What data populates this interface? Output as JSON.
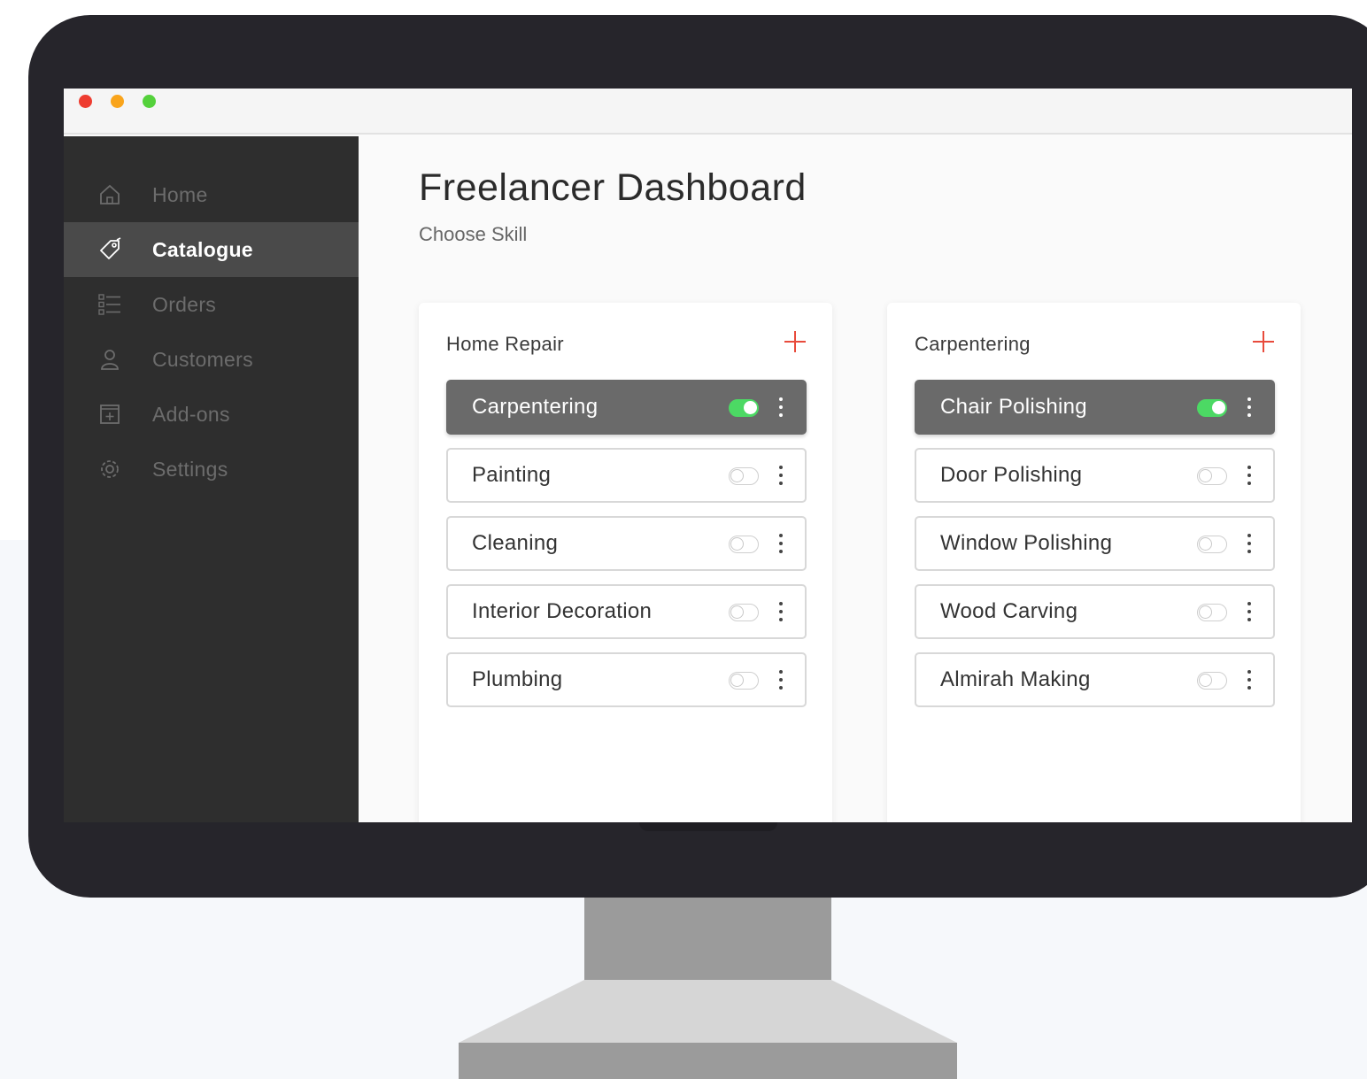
{
  "window": {
    "controls": [
      "close",
      "minimize",
      "maximize"
    ]
  },
  "sidebar": {
    "items": [
      {
        "label": "Home",
        "icon": "home-icon",
        "active": false
      },
      {
        "label": "Catalogue",
        "icon": "tag-icon",
        "active": true
      },
      {
        "label": "Orders",
        "icon": "list-icon",
        "active": false
      },
      {
        "label": "Customers",
        "icon": "user-icon",
        "active": false
      },
      {
        "label": "Add-ons",
        "icon": "add-box-icon",
        "active": false
      },
      {
        "label": "Settings",
        "icon": "gear-icon",
        "active": false
      }
    ]
  },
  "main": {
    "title": "Freelancer Dashboard",
    "subtitle": "Choose Skill"
  },
  "cards": [
    {
      "title": "Home Repair",
      "skills": [
        {
          "label": "Carpentering",
          "enabled": true
        },
        {
          "label": "Painting",
          "enabled": false
        },
        {
          "label": "Cleaning",
          "enabled": false
        },
        {
          "label": "Interior Decoration",
          "enabled": false
        },
        {
          "label": "Plumbing",
          "enabled": false
        }
      ]
    },
    {
      "title": "Carpentering",
      "skills": [
        {
          "label": "Chair Polishing",
          "enabled": true
        },
        {
          "label": "Door Polishing",
          "enabled": false
        },
        {
          "label": "Window Polishing",
          "enabled": false
        },
        {
          "label": "Wood Carving",
          "enabled": false
        },
        {
          "label": "Almirah Making",
          "enabled": false
        }
      ]
    }
  ],
  "colors": {
    "accent_add": "#e84b3c",
    "toggle_on": "#4cd964",
    "sidebar_bg": "#2e2e2e",
    "sidebar_active": "#4a4a4a",
    "row_active": "#6a6a6a"
  }
}
